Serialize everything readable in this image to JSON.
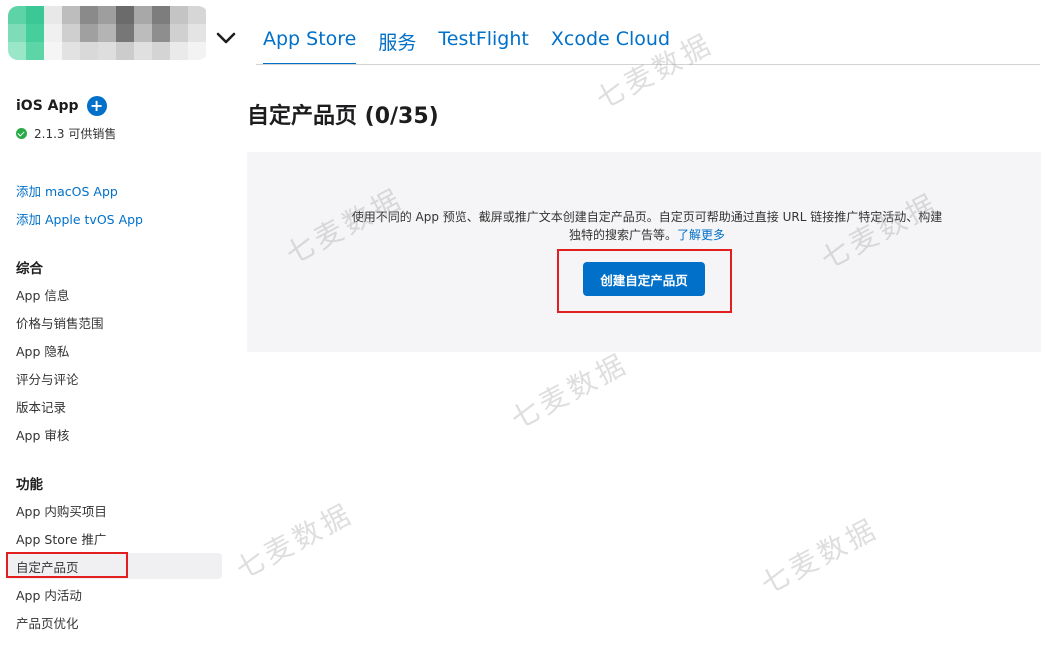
{
  "header": {
    "tabs": [
      {
        "label": "App Store"
      },
      {
        "label": "服务"
      },
      {
        "label": "TestFlight"
      },
      {
        "label": "Xcode Cloud"
      }
    ]
  },
  "sidebar": {
    "app_title": "iOS App",
    "add_icon": "plus-circle-icon",
    "version_status": "2.1.3 可供销售",
    "add_links": [
      "添加 macOS App",
      "添加 Apple tvOS App"
    ],
    "sections": [
      {
        "heading": "综合",
        "items": [
          "App 信息",
          "价格与销售范围",
          "App 隐私",
          "评分与评论",
          "版本记录",
          "App 审核"
        ]
      },
      {
        "heading": "功能",
        "items": [
          "App 内购买项目",
          "App Store 推广",
          "自定产品页",
          "App 内活动",
          "产品页优化"
        ]
      }
    ],
    "selected_item": "自定产品页"
  },
  "main": {
    "title": "自定产品页 (0/35)",
    "description": "使用不同的 App 预览、截屏或推广文本创建自定产品页。自定页可帮助通过直接 URL 链接推广特定活动、构建独特的搜索广告等。",
    "learn_more": "了解更多",
    "create_button": "创建自定产品页"
  },
  "watermark": "七麦数据",
  "colors": {
    "accent": "#0070c9",
    "highlight_box": "#e31e1e",
    "status_green": "#2bab45",
    "panel_bg": "#f5f5f7"
  }
}
